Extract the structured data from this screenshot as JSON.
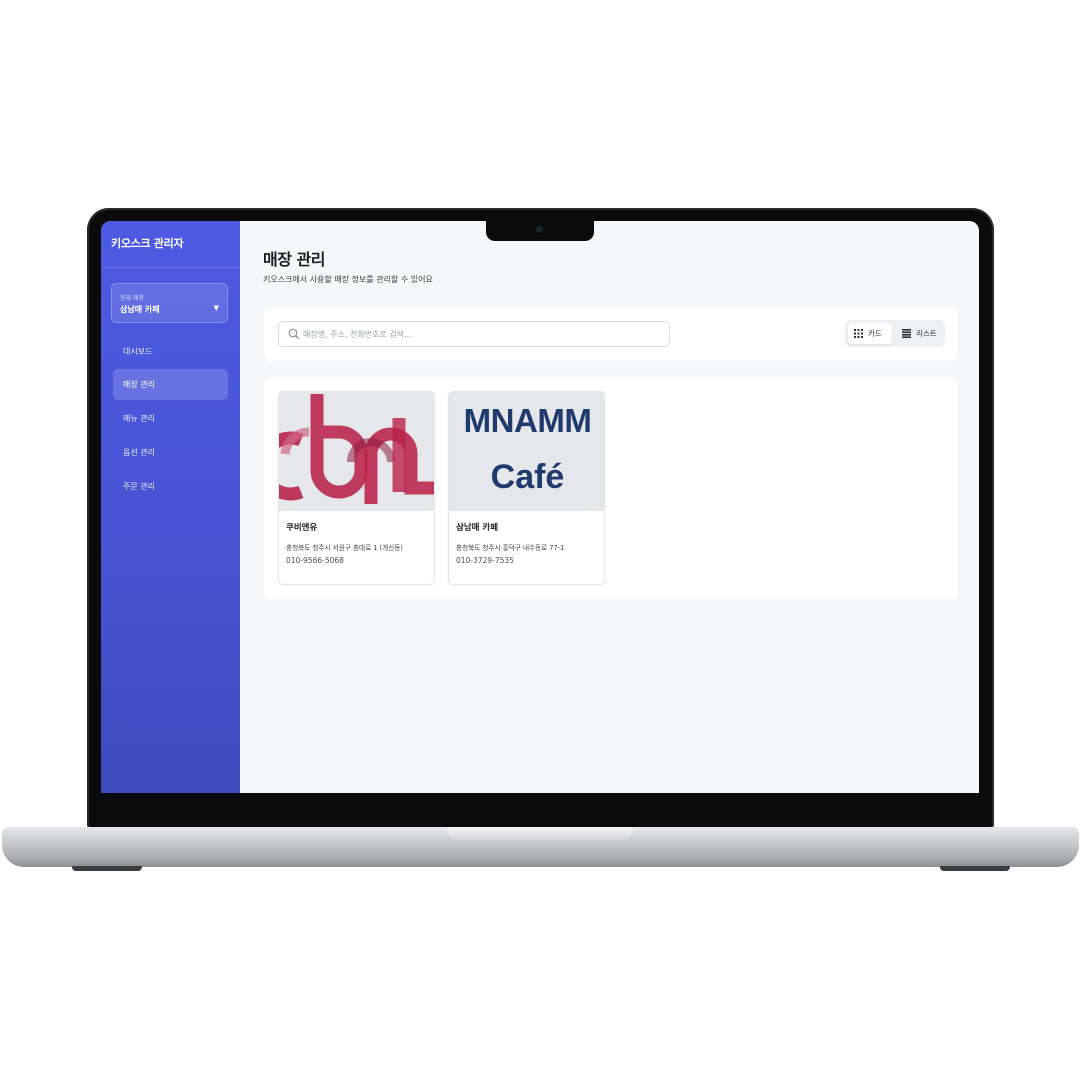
{
  "sidebar": {
    "app_title": "키오스크 관리자",
    "store_selector": {
      "caption": "현재 매장",
      "value": "삼남매 카페",
      "caret": "▼"
    },
    "items": [
      {
        "label": "대시보드",
        "active": false
      },
      {
        "label": "매장 관리",
        "active": true
      },
      {
        "label": "메뉴 관리",
        "active": false
      },
      {
        "label": "옵션 관리",
        "active": false
      },
      {
        "label": "주문 관리",
        "active": false
      }
    ]
  },
  "main": {
    "title": "매장 관리",
    "subtitle": "키오스크에서 사용할 매장 정보를 관리할 수 있어요",
    "search": {
      "placeholder": "매장명, 주소, 전화번호로 검색...",
      "value": ""
    },
    "view_toggle": {
      "card_label": "카드",
      "list_label": "리스트",
      "selected": "card"
    },
    "stores": [
      {
        "name": "쿠비엔유",
        "address": "충청북도 청주시 서원구 충대로 1 (개신동)",
        "phone": "010-9566-5068",
        "logo": "cbnu-logo"
      },
      {
        "name": "삼남매 카페",
        "address": "충청북도 청주시 흥덕구 내수동로 77-1",
        "phone": "010-3729-7535",
        "logo_line1": "MNAMM",
        "logo_line2": "Café"
      }
    ]
  },
  "colors": {
    "sidebar": "#4654d3",
    "background": "#f6f7f9",
    "cbnu_logo": "#b8234a",
    "cafe_logo_text": "#1e3a6e"
  }
}
